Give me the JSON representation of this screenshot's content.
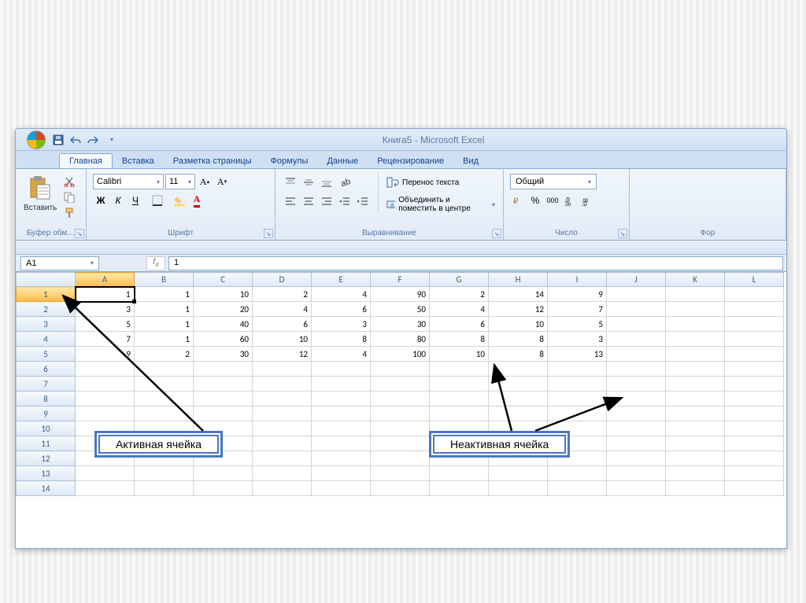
{
  "window": {
    "title": "Книга5 - Microsoft Excel"
  },
  "tabs": [
    "Главная",
    "Вставка",
    "Разметка страницы",
    "Формулы",
    "Данные",
    "Рецензирование",
    "Вид"
  ],
  "activeTab": "Главная",
  "clipboard": {
    "paste": "Вставить",
    "label": "Буфер обм…"
  },
  "font": {
    "name": "Calibri",
    "size": "11",
    "label": "Шрифт",
    "bold": "Ж",
    "italic": "К",
    "underline": "Ч"
  },
  "alignment": {
    "wrap": "Перенос текста",
    "merge": "Объединить и поместить в центре",
    "label": "Выравнивание"
  },
  "number": {
    "format": "Общий",
    "label": "Число"
  },
  "styles_label": "Фор",
  "name_box": "A1",
  "formula": "1",
  "columns": [
    "A",
    "B",
    "C",
    "D",
    "E",
    "F",
    "G",
    "H",
    "I",
    "J",
    "K",
    "L"
  ],
  "rows": 14,
  "data": [
    [
      "1",
      "1",
      "10",
      "2",
      "4",
      "90",
      "2",
      "14",
      "9",
      "",
      "",
      ""
    ],
    [
      "3",
      "1",
      "20",
      "4",
      "6",
      "50",
      "4",
      "12",
      "7",
      "",
      "",
      ""
    ],
    [
      "5",
      "1",
      "40",
      "6",
      "3",
      "30",
      "6",
      "10",
      "5",
      "",
      "",
      ""
    ],
    [
      "7",
      "1",
      "60",
      "10",
      "8",
      "80",
      "8",
      "8",
      "3",
      "",
      "",
      ""
    ],
    [
      "9",
      "2",
      "30",
      "12",
      "4",
      "100",
      "10",
      "8",
      "13",
      "",
      "",
      ""
    ]
  ],
  "callouts": {
    "active": "Активная ячейка",
    "inactive": "Неактивная ячейка"
  },
  "chart_data": {
    "type": "table",
    "title": "Excel spreadsheet data (Range A1:I5)",
    "columns": [
      "A",
      "B",
      "C",
      "D",
      "E",
      "F",
      "G",
      "H",
      "I"
    ],
    "rows": [
      [
        1,
        1,
        10,
        2,
        4,
        90,
        2,
        14,
        9
      ],
      [
        3,
        1,
        20,
        4,
        6,
        50,
        4,
        12,
        7
      ],
      [
        5,
        1,
        40,
        6,
        3,
        30,
        6,
        10,
        5
      ],
      [
        7,
        1,
        60,
        10,
        8,
        80,
        8,
        8,
        3
      ],
      [
        9,
        2,
        30,
        12,
        4,
        100,
        10,
        8,
        13
      ]
    ]
  }
}
